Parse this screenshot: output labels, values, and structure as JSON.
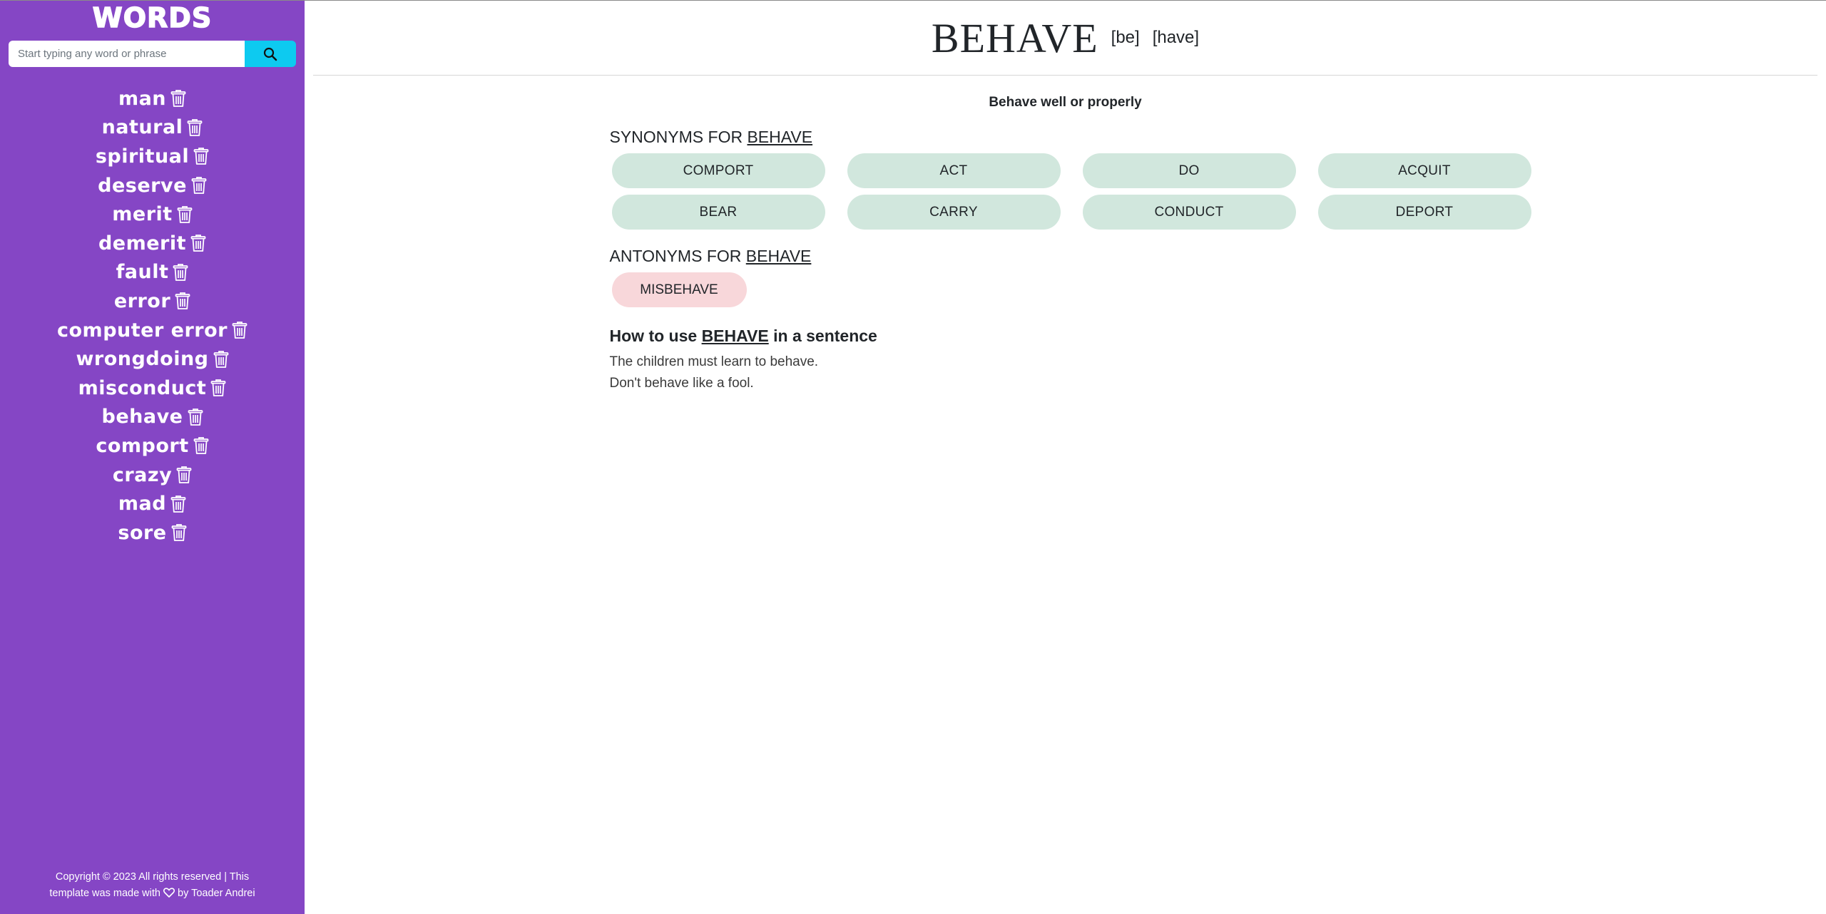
{
  "sidebar": {
    "logo": "WORDS",
    "search": {
      "placeholder": "Start typing any word or phrase",
      "value": ""
    },
    "history": [
      "man",
      "natural",
      "spiritual",
      "deserve",
      "merit",
      "demerit",
      "fault",
      "error",
      "computer error",
      "wrongdoing",
      "misconduct",
      "behave",
      "comport",
      "crazy",
      "mad",
      "sore"
    ],
    "footer": {
      "line1": "Copyright © 2023 All rights reserved | This",
      "line2_pre": "template was made with",
      "line2_post": "by Toader Andrei"
    }
  },
  "word": {
    "title": "BEHAVE",
    "syllables": [
      "[be]",
      "[have]"
    ],
    "definition": "Behave well or properly"
  },
  "synonyms": {
    "label": "SYNONYMS FOR",
    "word": "BEHAVE",
    "items": [
      "COMPORT",
      "ACT",
      "DO",
      "ACQUIT",
      "BEAR",
      "CARRY",
      "CONDUCT",
      "DEPORT"
    ]
  },
  "antonyms": {
    "label": "ANTONYMS FOR",
    "word": "BEHAVE",
    "items": [
      "MISBEHAVE"
    ]
  },
  "usage": {
    "pre": "How to use",
    "word": "BEHAVE",
    "post": "in a sentence",
    "sentences": [
      "The children must learn to behave.",
      "Don't behave like a fool."
    ]
  },
  "colors": {
    "sidebar": "#8546c5",
    "search_button": "#0dcaf0",
    "synonym_chip": "#d1e7dd",
    "antonym_chip": "#f8d7da"
  },
  "icons": {
    "search": "search-icon",
    "delete": "trash-icon",
    "heart": "heart-icon"
  }
}
